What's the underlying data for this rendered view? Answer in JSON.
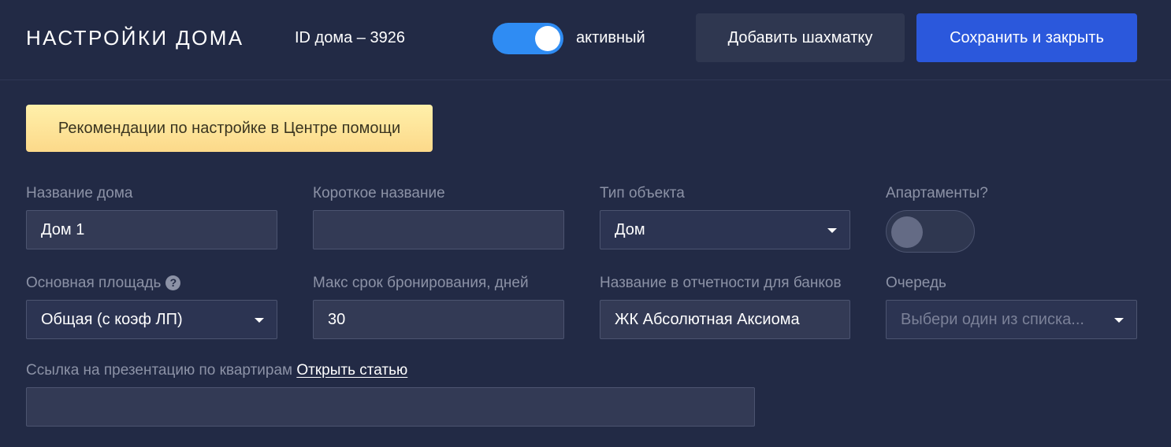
{
  "header": {
    "title": "НАСТРОЙКИ ДОМА",
    "house_id": "ID дома – 3926",
    "active_toggle": {
      "label": "активный",
      "on": true
    },
    "add_chessboard_label": "Добавить шахматку",
    "save_close_label": "Сохранить и закрыть"
  },
  "help_banner": "Рекомендации по настройке в Центре помощи",
  "fields": {
    "house_name": {
      "label": "Название дома",
      "value": "Дом 1"
    },
    "short_name": {
      "label": "Короткое название",
      "value": ""
    },
    "object_type": {
      "label": "Тип объекта",
      "value": "Дом"
    },
    "apartments": {
      "label": "Апартаменты?",
      "on": false
    },
    "main_area": {
      "label": "Основная площадь",
      "value": "Общая (с коэф ЛП)"
    },
    "max_booking": {
      "label": "Макс срок бронирования, дней",
      "value": "30"
    },
    "bank_report_name": {
      "label": "Название в отчетности для банков",
      "value": "ЖК Абсолютная Аксиома"
    },
    "queue": {
      "label": "Очередь",
      "placeholder": "Выбери один из списка..."
    },
    "presentation_link": {
      "label": "Ссылка на презентацию по квартирам",
      "link_text": "Открыть статью",
      "value": ""
    }
  },
  "colors": {
    "background": "#222a45",
    "primary": "#2b58dc",
    "toggle_on": "#2f8cf3",
    "banner": "#fde8a0"
  }
}
